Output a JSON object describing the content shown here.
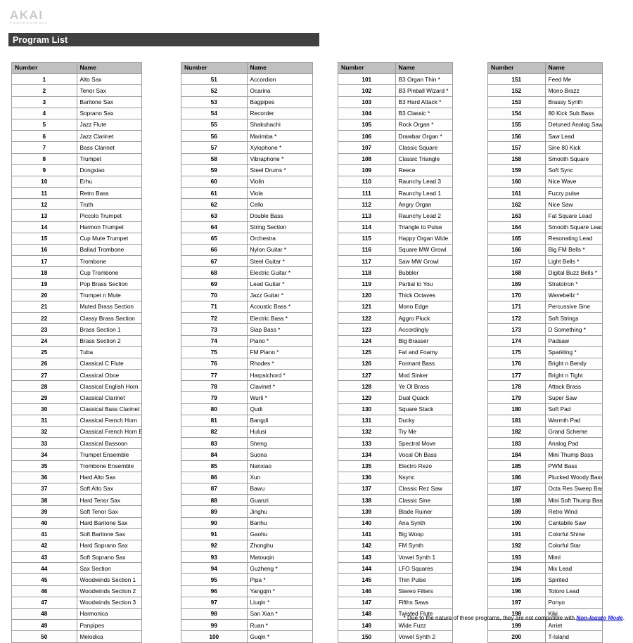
{
  "brand": {
    "name": "AKAI",
    "tagline": "PROFESSIONAL"
  },
  "header": {
    "title": "Program List"
  },
  "table": {
    "columns": [
      "Number",
      "Name"
    ]
  },
  "footnote": {
    "prefix": "* Due to the nature of these programs, they are not compatible with ",
    "link": "Non-legato Mode",
    "suffix": "."
  },
  "programs": [
    [
      {
        "number": "1",
        "name": "Alto Sax"
      },
      {
        "number": "2",
        "name": "Tenor Sax"
      },
      {
        "number": "3",
        "name": "Baritone Sax"
      },
      {
        "number": "4",
        "name": "Soprano Sax"
      },
      {
        "number": "5",
        "name": "Jazz Flute"
      },
      {
        "number": "6",
        "name": "Jazz Clarinet"
      },
      {
        "number": "7",
        "name": "Bass Clarinet"
      },
      {
        "number": "8",
        "name": "Trumpet"
      },
      {
        "number": "9",
        "name": "Dongxiao"
      },
      {
        "number": "10",
        "name": "Erhu"
      },
      {
        "number": "11",
        "name": "Retro Bass"
      },
      {
        "number": "12",
        "name": "Truth"
      },
      {
        "number": "13",
        "name": "Piccolo Trumpet"
      },
      {
        "number": "14",
        "name": "Harmon Trumpet"
      },
      {
        "number": "15",
        "name": "Cup Mute Trumpet"
      },
      {
        "number": "16",
        "name": "Ballad Trombone"
      },
      {
        "number": "17",
        "name": "Trombone"
      },
      {
        "number": "18",
        "name": "Cup Trombone"
      },
      {
        "number": "19",
        "name": "Pop Brass Section"
      },
      {
        "number": "20",
        "name": "Trumpet n Mute"
      },
      {
        "number": "21",
        "name": "Muted Brass Section"
      },
      {
        "number": "22",
        "name": "Classy Brass Section"
      },
      {
        "number": "23",
        "name": "Brass Section 1"
      },
      {
        "number": "24",
        "name": "Brass Section 2"
      },
      {
        "number": "25",
        "name": "Tuba"
      },
      {
        "number": "26",
        "name": "Classical C Flute"
      },
      {
        "number": "27",
        "name": "Classical Oboe"
      },
      {
        "number": "28",
        "name": "Classical English Horn"
      },
      {
        "number": "29",
        "name": "Classical Clarinet"
      },
      {
        "number": "30",
        "name": "Classical Bass Clarinet"
      },
      {
        "number": "31",
        "name": "Classical French Horn"
      },
      {
        "number": "32",
        "name": "Classical French Horn Bells Up"
      },
      {
        "number": "33",
        "name": "Classical Bassoon"
      },
      {
        "number": "34",
        "name": "Trumpet Ensemble"
      },
      {
        "number": "35",
        "name": "Trombone Ensemble"
      },
      {
        "number": "36",
        "name": "Hard Alto Sax"
      },
      {
        "number": "37",
        "name": "Soft Alto Sax"
      },
      {
        "number": "38",
        "name": "Hard Tenor Sax"
      },
      {
        "number": "39",
        "name": "Soft Tenor Sax"
      },
      {
        "number": "40",
        "name": "Hard Baritone Sax"
      },
      {
        "number": "41",
        "name": "Soft Baritone Sax"
      },
      {
        "number": "42",
        "name": "Hard Soprano Sax"
      },
      {
        "number": "43",
        "name": "Soft Soprano Sax"
      },
      {
        "number": "44",
        "name": "Sax Section"
      },
      {
        "number": "45",
        "name": "Woodwinds Section 1"
      },
      {
        "number": "46",
        "name": "Woodwinds Section 2"
      },
      {
        "number": "47",
        "name": "Woodwinds Section 3"
      },
      {
        "number": "48",
        "name": "Harmonica"
      },
      {
        "number": "49",
        "name": "Panpipes"
      },
      {
        "number": "50",
        "name": "Melodica"
      }
    ],
    [
      {
        "number": "51",
        "name": "Accordion"
      },
      {
        "number": "52",
        "name": "Ocarina"
      },
      {
        "number": "53",
        "name": "Bagpipes"
      },
      {
        "number": "54",
        "name": "Recorder"
      },
      {
        "number": "55",
        "name": "Shakuhachi"
      },
      {
        "number": "56",
        "name": "Marimba *"
      },
      {
        "number": "57",
        "name": "Xylophone *"
      },
      {
        "number": "58",
        "name": "Vibraphone *"
      },
      {
        "number": "59",
        "name": "Steel Drums *"
      },
      {
        "number": "60",
        "name": "Violin"
      },
      {
        "number": "61",
        "name": "Viola"
      },
      {
        "number": "62",
        "name": "Cello"
      },
      {
        "number": "63",
        "name": "Double Bass"
      },
      {
        "number": "64",
        "name": "String Section"
      },
      {
        "number": "65",
        "name": "Orchestra"
      },
      {
        "number": "66",
        "name": "Nylon Guitar *"
      },
      {
        "number": "67",
        "name": "Steel Guitar *"
      },
      {
        "number": "68",
        "name": "Electric Guitar *"
      },
      {
        "number": "69",
        "name": "Lead Guitar *"
      },
      {
        "number": "70",
        "name": "Jazz Guitar *"
      },
      {
        "number": "71",
        "name": "Acoustic Bass *"
      },
      {
        "number": "72",
        "name": "Electric Bass *"
      },
      {
        "number": "73",
        "name": "Slap Bass *"
      },
      {
        "number": "74",
        "name": "Piano *"
      },
      {
        "number": "75",
        "name": "FM Piano *"
      },
      {
        "number": "76",
        "name": "Rhodes *"
      },
      {
        "number": "77",
        "name": "Harpsichord *"
      },
      {
        "number": "78",
        "name": "Clavinet *"
      },
      {
        "number": "79",
        "name": "Wurli *"
      },
      {
        "number": "80",
        "name": "Qudi"
      },
      {
        "number": "81",
        "name": "Bangdi"
      },
      {
        "number": "82",
        "name": "Hulusi"
      },
      {
        "number": "83",
        "name": "Sheng"
      },
      {
        "number": "84",
        "name": "Suona"
      },
      {
        "number": "85",
        "name": "Nanxiao"
      },
      {
        "number": "86",
        "name": "Xun"
      },
      {
        "number": "87",
        "name": "Bawu"
      },
      {
        "number": "88",
        "name": "Guanzi"
      },
      {
        "number": "89",
        "name": "Jinghu"
      },
      {
        "number": "90",
        "name": "Banhu"
      },
      {
        "number": "91",
        "name": "Gaohu"
      },
      {
        "number": "92",
        "name": "Zhonghu"
      },
      {
        "number": "93",
        "name": "Matouqin"
      },
      {
        "number": "94",
        "name": "Guzheng *"
      },
      {
        "number": "95",
        "name": "Pipa *"
      },
      {
        "number": "96",
        "name": "Yangqin *"
      },
      {
        "number": "97",
        "name": "Liuqin *"
      },
      {
        "number": "98",
        "name": "San Xian *"
      },
      {
        "number": "99",
        "name": "Ruan *"
      },
      {
        "number": "100",
        "name": "Guqin *"
      }
    ],
    [
      {
        "number": "101",
        "name": "B3 Organ Thin *"
      },
      {
        "number": "102",
        "name": "B3 Pinball Wizard *"
      },
      {
        "number": "103",
        "name": "B3 Hard Attack *"
      },
      {
        "number": "104",
        "name": "B3 Classic *"
      },
      {
        "number": "105",
        "name": "Rock Organ *"
      },
      {
        "number": "106",
        "name": "Drawbar Organ *"
      },
      {
        "number": "107",
        "name": "Classic Square"
      },
      {
        "number": "108",
        "name": "Classic Triangle"
      },
      {
        "number": "109",
        "name": "Reece"
      },
      {
        "number": "110",
        "name": "Raunchy Lead 3"
      },
      {
        "number": "111",
        "name": "Raunchy Lead 1"
      },
      {
        "number": "112",
        "name": "Angry Organ"
      },
      {
        "number": "113",
        "name": "Raunchy Lead 2"
      },
      {
        "number": "114",
        "name": "Triangle to Pulse"
      },
      {
        "number": "115",
        "name": "Happy Organ Wide"
      },
      {
        "number": "116",
        "name": "Square MW Growl"
      },
      {
        "number": "117",
        "name": "Saw MW Growl"
      },
      {
        "number": "118",
        "name": "Bubbler"
      },
      {
        "number": "119",
        "name": "Partial to You"
      },
      {
        "number": "120",
        "name": "Thick Octaves"
      },
      {
        "number": "121",
        "name": "Mono Edge"
      },
      {
        "number": "122",
        "name": "Aggro Pluck"
      },
      {
        "number": "123",
        "name": "Accordingly"
      },
      {
        "number": "124",
        "name": "Big Brasser"
      },
      {
        "number": "125",
        "name": "Fat and Foamy"
      },
      {
        "number": "126",
        "name": "Formant Bass"
      },
      {
        "number": "127",
        "name": "Mod Sinker"
      },
      {
        "number": "128",
        "name": "Ye Ol Brass"
      },
      {
        "number": "129",
        "name": "Dual Quack"
      },
      {
        "number": "130",
        "name": "Square Stack"
      },
      {
        "number": "131",
        "name": "Ducky"
      },
      {
        "number": "132",
        "name": "Try Me"
      },
      {
        "number": "133",
        "name": "Spectral Move"
      },
      {
        "number": "134",
        "name": "Vocal Oh Bass"
      },
      {
        "number": "135",
        "name": "Electro Rezo"
      },
      {
        "number": "136",
        "name": "Nsync"
      },
      {
        "number": "137",
        "name": "Classic Rez Saw"
      },
      {
        "number": "138",
        "name": "Classic Sine"
      },
      {
        "number": "139",
        "name": "Blade Ruiner"
      },
      {
        "number": "140",
        "name": "Ana Synth"
      },
      {
        "number": "141",
        "name": "Big Woop"
      },
      {
        "number": "142",
        "name": "FM Synth"
      },
      {
        "number": "143",
        "name": "Vowel Synth 1"
      },
      {
        "number": "144",
        "name": "LFO Squares"
      },
      {
        "number": "145",
        "name": "Thin Pulse"
      },
      {
        "number": "146",
        "name": "Stereo Filters"
      },
      {
        "number": "147",
        "name": "Fifths Saws"
      },
      {
        "number": "148",
        "name": "Twisted Flute"
      },
      {
        "number": "149",
        "name": "Wide Fuzz"
      },
      {
        "number": "150",
        "name": "Vowel Synth 2"
      }
    ],
    [
      {
        "number": "151",
        "name": "Feed Me"
      },
      {
        "number": "152",
        "name": "Mono Brazz"
      },
      {
        "number": "153",
        "name": "Brassy Synth"
      },
      {
        "number": "154",
        "name": "80 Kick Sub Bass"
      },
      {
        "number": "155",
        "name": "Detuned Analog Saw"
      },
      {
        "number": "156",
        "name": "Saw Lead"
      },
      {
        "number": "157",
        "name": "Sine 80 Kick"
      },
      {
        "number": "158",
        "name": "Smooth Square"
      },
      {
        "number": "159",
        "name": "Soft Sync"
      },
      {
        "number": "160",
        "name": "Nice Wave"
      },
      {
        "number": "161",
        "name": "Fuzzy pulse"
      },
      {
        "number": "162",
        "name": "Nice Saw"
      },
      {
        "number": "163",
        "name": "Fat Square Lead"
      },
      {
        "number": "164",
        "name": "Smooth Square Lead"
      },
      {
        "number": "165",
        "name": "Resonating Lead"
      },
      {
        "number": "166",
        "name": "Big FM Bells *"
      },
      {
        "number": "167",
        "name": "Light Bells *"
      },
      {
        "number": "168",
        "name": "Digital Buzz Bells *"
      },
      {
        "number": "169",
        "name": "Stratotron *"
      },
      {
        "number": "170",
        "name": "Wavebellz *"
      },
      {
        "number": "171",
        "name": "Percussive Sine"
      },
      {
        "number": "172",
        "name": "Soft Strings"
      },
      {
        "number": "173",
        "name": "D Something *"
      },
      {
        "number": "174",
        "name": "Padsaw"
      },
      {
        "number": "175",
        "name": "Sparkling *"
      },
      {
        "number": "176",
        "name": "Bright n Bendy"
      },
      {
        "number": "177",
        "name": "Bright n Tight"
      },
      {
        "number": "178",
        "name": "Attack Brass"
      },
      {
        "number": "179",
        "name": "Super Saw"
      },
      {
        "number": "180",
        "name": "Soft Pad"
      },
      {
        "number": "181",
        "name": "Warmth Pad"
      },
      {
        "number": "182",
        "name": "Grand Scheme"
      },
      {
        "number": "183",
        "name": "Analog Pad"
      },
      {
        "number": "184",
        "name": "Mini Thump Bass"
      },
      {
        "number": "185",
        "name": "PWM Bass"
      },
      {
        "number": "186",
        "name": "Plucked Woody Bass"
      },
      {
        "number": "187",
        "name": "Octa Res Sweep Bass"
      },
      {
        "number": "188",
        "name": "Mini Soft Thump Bass"
      },
      {
        "number": "189",
        "name": "Retro Wind"
      },
      {
        "number": "190",
        "name": "Cantabile Saw"
      },
      {
        "number": "191",
        "name": "Colorful Shine"
      },
      {
        "number": "192",
        "name": "Colorful Star"
      },
      {
        "number": "193",
        "name": "Mimi"
      },
      {
        "number": "194",
        "name": "Mix Lead"
      },
      {
        "number": "195",
        "name": "Spirited"
      },
      {
        "number": "196",
        "name": "Totoro Lead"
      },
      {
        "number": "197",
        "name": "Ponyo"
      },
      {
        "number": "198",
        "name": "Kiki"
      },
      {
        "number": "199",
        "name": "Arriet"
      },
      {
        "number": "200",
        "name": "T-Island"
      }
    ]
  ],
  "colors": {
    "title_bar": "#404040",
    "table_header": "#c0c0c0",
    "link": "#2020cc",
    "border": "#9a9a9a"
  }
}
